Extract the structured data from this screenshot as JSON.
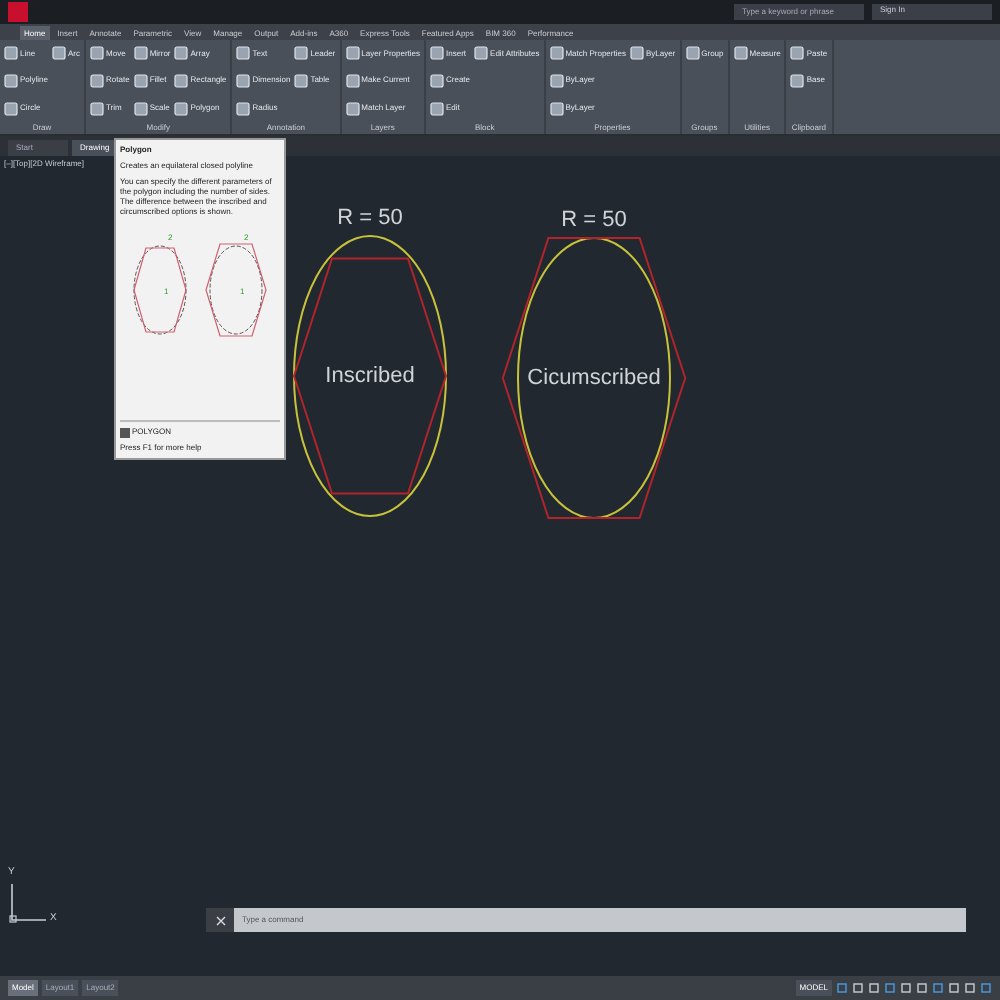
{
  "title_bar": {
    "search": {
      "placeholder": "Type a keyword or phrase"
    },
    "sign_in": "Sign In"
  },
  "ribbon_tabs": [
    {
      "label": "Home",
      "selected": true
    },
    {
      "label": "Insert",
      "selected": false
    },
    {
      "label": "Annotate",
      "selected": false
    },
    {
      "label": "Parametric",
      "selected": false
    },
    {
      "label": "View",
      "selected": false
    },
    {
      "label": "Manage",
      "selected": false
    },
    {
      "label": "Output",
      "selected": false
    },
    {
      "label": "Add-ins",
      "selected": false
    },
    {
      "label": "A360",
      "selected": false
    },
    {
      "label": "Express Tools",
      "selected": false
    },
    {
      "label": "Featured Apps",
      "selected": false
    },
    {
      "label": "BIM 360",
      "selected": false
    },
    {
      "label": "Performance",
      "selected": false
    }
  ],
  "panels": [
    {
      "title": "Draw",
      "tools": [
        "Line",
        "Polyline",
        "Circle",
        "Arc"
      ]
    },
    {
      "title": "Modify",
      "tools": [
        "Move",
        "Rotate",
        "Trim",
        "Mirror",
        "Fillet",
        "Scale",
        "Array",
        "Rectangle",
        "Polygon"
      ]
    },
    {
      "title": "Annotation",
      "tools": [
        "Text",
        "Dimension",
        "Radius",
        "Leader",
        "Table"
      ]
    },
    {
      "title": "Layers",
      "tools": [
        "Layer Properties",
        "Make Current",
        "Match Layer"
      ]
    },
    {
      "title": "Block",
      "tools": [
        "Insert",
        "Create",
        "Edit",
        "Edit Attributes"
      ]
    },
    {
      "title": "Properties",
      "tools": [
        "Match Properties",
        "ByLayer",
        "ByLayer",
        "ByLayer"
      ]
    },
    {
      "title": "Groups",
      "tools": [
        "Group"
      ]
    },
    {
      "title": "Utilities",
      "tools": [
        "Measure"
      ]
    },
    {
      "title": "Clipboard",
      "tools": [
        "Paste",
        "Base"
      ]
    }
  ],
  "file_tabs": [
    {
      "label": "Start",
      "selected": false
    },
    {
      "label": "Drawing",
      "selected": true
    }
  ],
  "viewport_label": "[–][Top][2D Wireframe]",
  "tooltip": {
    "title": "Polygon",
    "summary": "Creates an equilateral closed polyline",
    "description": "You can specify the different parameters of the polygon including the number of sides. The difference between the inscribed and circumscribed options is shown.",
    "marks": [
      "2",
      "1",
      "2",
      "1"
    ],
    "command": "POLYGON",
    "help": "Press F1 for more help"
  },
  "drawing": {
    "shapes": [
      {
        "kind": "inscribed",
        "radius_label": "R = 50",
        "label": "Inscribed"
      },
      {
        "kind": "circumscribed",
        "radius_label": "R = 50",
        "label": "Cicumscribed"
      }
    ]
  },
  "ucs": {
    "y": "Y",
    "x": "X"
  },
  "command_line": {
    "placeholder": "Type a command"
  },
  "layout_tabs": [
    {
      "label": "Model",
      "selected": true
    },
    {
      "label": "Layout1",
      "selected": false
    },
    {
      "label": "Layout2",
      "selected": false
    }
  ],
  "status_bar": {
    "mode": "MODEL"
  }
}
